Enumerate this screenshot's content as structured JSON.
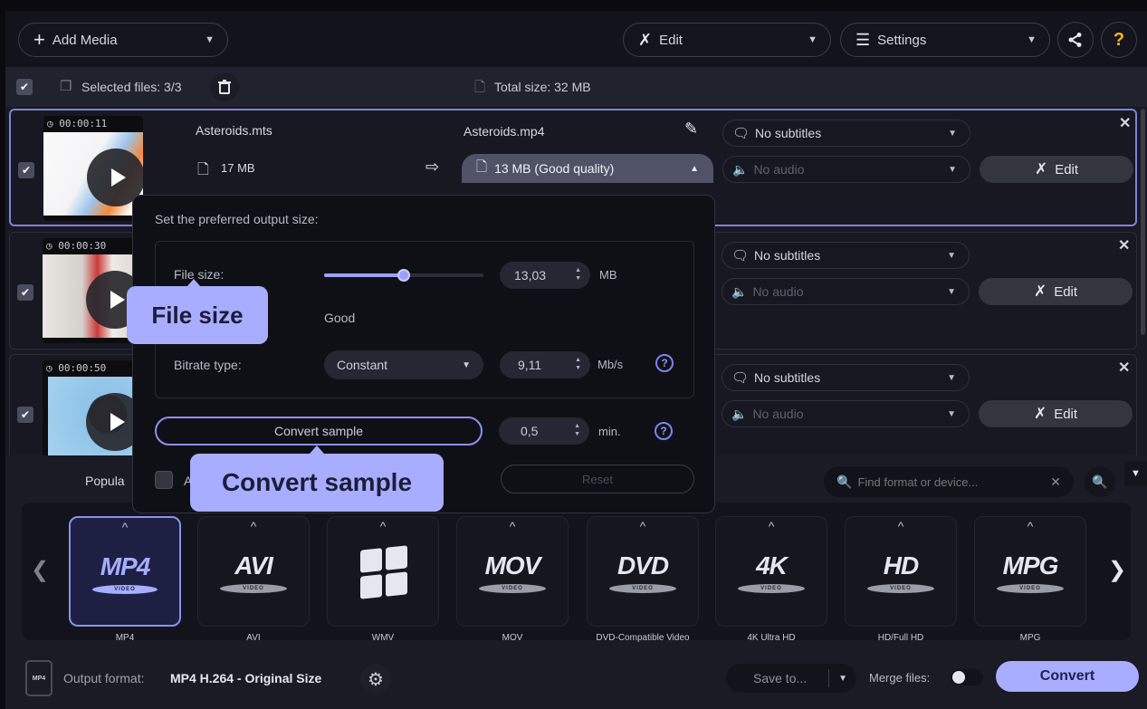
{
  "toolbar": {
    "add_media": "Add Media",
    "edit": "Edit",
    "settings": "Settings"
  },
  "selection": {
    "selected_files": "Selected files: 3/3",
    "total_size": "Total size: 32 MB"
  },
  "files": [
    {
      "duration": "00:00:11",
      "source_name": "Asteroids.mts",
      "source_size": "17 MB",
      "output_name": "Asteroids.mp4",
      "output_size": "13 MB (Good quality)",
      "subtitles": "No subtitles",
      "audio": "No audio",
      "edit_label": "Edit",
      "selected": true
    },
    {
      "duration": "00:00:30",
      "subtitles": "No subtitles",
      "audio": "No audio",
      "edit_label": "Edit",
      "selected": true
    },
    {
      "duration": "00:00:50",
      "subtitles": "No subtitles",
      "audio": "No audio",
      "edit_label": "Edit",
      "selected": true
    }
  ],
  "size_popup": {
    "title": "Set the preferred output size:",
    "file_size_label": "File size:",
    "file_size_value": "13,03",
    "file_size_unit": "MB",
    "file_size_slider_fraction": 0.5,
    "quality_label": "Good",
    "bitrate_type_label": "Bitrate type:",
    "bitrate_type_value": "Constant",
    "bitrate_value": "9,11",
    "bitrate_unit": "Mb/s",
    "convert_sample_label": "Convert sample",
    "sample_length_value": "0,5",
    "sample_length_unit": "min.",
    "checkbox_label_partial": "A",
    "reset_label": "Reset"
  },
  "tooltips": {
    "file_size": "File size",
    "convert_sample": "Convert sample"
  },
  "formats": {
    "tab_partial": "Popula",
    "search_placeholder": "Find format or device...",
    "items": [
      {
        "logo": "MP4",
        "name": "MP4",
        "selected": true
      },
      {
        "logo": "AVI",
        "name": "AVI"
      },
      {
        "logo": "windows-logo",
        "name": "WMV"
      },
      {
        "logo": "MOV",
        "name": "MOV"
      },
      {
        "logo": "DVD",
        "name": "DVD-Compatible Video"
      },
      {
        "logo": "4K",
        "name": "4K Ultra HD"
      },
      {
        "logo": "HD",
        "name": "HD/Full HD"
      },
      {
        "logo": "MPG",
        "name": "MPG"
      }
    ],
    "disc_label": "VIDEO"
  },
  "footer": {
    "output_format_label": "Output format:",
    "output_format_value": "MP4 H.264 - Original Size",
    "save_to": "Save to...",
    "merge_files": "Merge files:",
    "convert": "Convert"
  },
  "colors": {
    "accent": "#a9adff",
    "selection_border": "#7d83d8",
    "help_icon": "#ffb020"
  }
}
